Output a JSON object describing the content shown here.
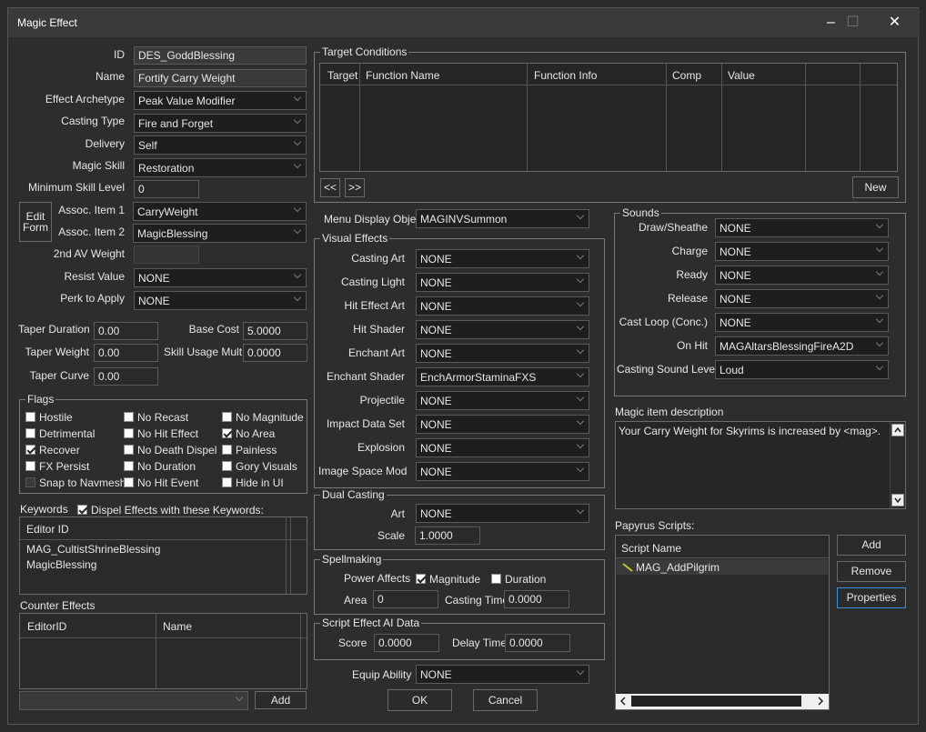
{
  "window": {
    "title": "Magic Effect",
    "minimize": "–",
    "maximize": "☐",
    "close": "✕"
  },
  "form": {
    "id_label": "ID",
    "id_value": "DES_GoddBlessing",
    "name_label": "Name",
    "name_value": "Fortify Carry Weight",
    "archetype_label": "Effect Archetype",
    "archetype_value": "Peak Value Modifier",
    "casting_type_label": "Casting Type",
    "casting_type_value": "Fire and Forget",
    "delivery_label": "Delivery",
    "delivery_value": "Self",
    "magic_skill_label": "Magic Skill",
    "magic_skill_value": "Restoration",
    "min_skill_label": "Minimum Skill Level",
    "min_skill_value": "0",
    "edit_form_label": "Edit Form",
    "assoc1_label": "Assoc. Item 1",
    "assoc1_value": "CarryWeight",
    "assoc2_label": "Assoc. Item 2",
    "assoc2_value": "MagicBlessing",
    "second_av_label": "2nd AV Weight",
    "second_av_value": "",
    "resist_label": "Resist Value",
    "resist_value": "NONE",
    "perk_label": "Perk to Apply",
    "perk_value": "NONE",
    "taper_duration_label": "Taper Duration",
    "taper_duration_value": "0.00",
    "base_cost_label": "Base Cost",
    "base_cost_value": "5.0000",
    "taper_weight_label": "Taper Weight",
    "taper_weight_value": "0.00",
    "skill_usage_label": "Skill Usage Mult",
    "skill_usage_value": "0.0000",
    "taper_curve_label": "Taper Curve",
    "taper_curve_value": "0.00"
  },
  "flags": {
    "title": "Flags",
    "items": [
      {
        "label": "Hostile",
        "checked": false
      },
      {
        "label": "No Recast",
        "checked": false
      },
      {
        "label": "No Magnitude",
        "checked": false
      },
      {
        "label": "Detrimental",
        "checked": false
      },
      {
        "label": "No Hit Effect",
        "checked": false
      },
      {
        "label": "No Area",
        "checked": true
      },
      {
        "label": "Recover",
        "checked": true
      },
      {
        "label": "No Death Dispel",
        "checked": false
      },
      {
        "label": "Painless",
        "checked": false
      },
      {
        "label": "FX Persist",
        "checked": false
      },
      {
        "label": "No Duration",
        "checked": false
      },
      {
        "label": "Gory Visuals",
        "checked": false
      },
      {
        "label": "Snap to Navmesh",
        "checked": false
      },
      {
        "label": "No Hit Event",
        "checked": false
      },
      {
        "label": "Hide in UI",
        "checked": false
      }
    ]
  },
  "keywords": {
    "title": "Keywords",
    "dispel_label": "Dispel Effects with these Keywords:",
    "dispel_checked": true,
    "header": "Editor ID",
    "rows": [
      "MAG_CultistShrineBlessing",
      "MagicBlessing"
    ]
  },
  "counter": {
    "title": "Counter Effects",
    "col1": "EditorID",
    "col2": "Name",
    "add_label": "Add"
  },
  "target_conditions": {
    "title": "Target Conditions",
    "columns": [
      "Target",
      "Function Name",
      "Function Info",
      "Comp",
      "Value"
    ],
    "prev_label": "<<",
    "next_label": ">>",
    "new_label": "New"
  },
  "menu_display": {
    "label": "Menu Display Object",
    "value": "MAGINVSummon"
  },
  "visual_effects": {
    "title": "Visual Effects",
    "rows": [
      {
        "label": "Casting Art",
        "value": "NONE"
      },
      {
        "label": "Casting Light",
        "value": "NONE"
      },
      {
        "label": "Hit Effect Art",
        "value": "NONE"
      },
      {
        "label": "Hit Shader",
        "value": "NONE"
      },
      {
        "label": "Enchant Art",
        "value": "NONE"
      },
      {
        "label": "Enchant Shader",
        "value": "EnchArmorStaminaFXS"
      },
      {
        "label": "Projectile",
        "value": "NONE"
      },
      {
        "label": "Impact Data Set",
        "value": "NONE"
      },
      {
        "label": "Explosion",
        "value": "NONE"
      },
      {
        "label": "Image Space Mod",
        "value": "NONE"
      }
    ]
  },
  "dual_casting": {
    "title": "Dual Casting",
    "art_label": "Art",
    "art_value": "NONE",
    "scale_label": "Scale",
    "scale_value": "1.0000"
  },
  "spellmaking": {
    "title": "Spellmaking",
    "power_label": "Power Affects",
    "magnitude_label": "Magnitude",
    "magnitude_checked": true,
    "duration_label": "Duration",
    "duration_checked": false,
    "area_label": "Area",
    "area_value": "0",
    "casting_time_label": "Casting Time",
    "casting_time_value": "0.0000"
  },
  "script_ai": {
    "title": "Script Effect AI Data",
    "score_label": "Score",
    "score_value": "0.0000",
    "delay_label": "Delay Time",
    "delay_value": "0.0000"
  },
  "equip": {
    "label": "Equip Ability",
    "value": "NONE"
  },
  "ok_label": "OK",
  "cancel_label": "Cancel",
  "sounds": {
    "title": "Sounds",
    "rows": [
      {
        "label": "Draw/Sheathe",
        "value": "NONE"
      },
      {
        "label": "Charge",
        "value": "NONE"
      },
      {
        "label": "Ready",
        "value": "NONE"
      },
      {
        "label": "Release",
        "value": "NONE"
      },
      {
        "label": "Cast Loop (Conc.)",
        "value": "NONE"
      },
      {
        "label": "On Hit",
        "value": "MAGAltarsBlessingFireA2D"
      },
      {
        "label": "Casting Sound Level",
        "value": "Loud"
      }
    ]
  },
  "description": {
    "label": "Magic item description",
    "text": "Your Carry Weight for Skyrims is increased by <mag>."
  },
  "papyrus": {
    "title": "Papyrus Scripts:",
    "header": "Script Name",
    "scripts": [
      "MAG_AddPilgrim"
    ],
    "add_label": "Add",
    "remove_label": "Remove",
    "properties_label": "Properties"
  }
}
